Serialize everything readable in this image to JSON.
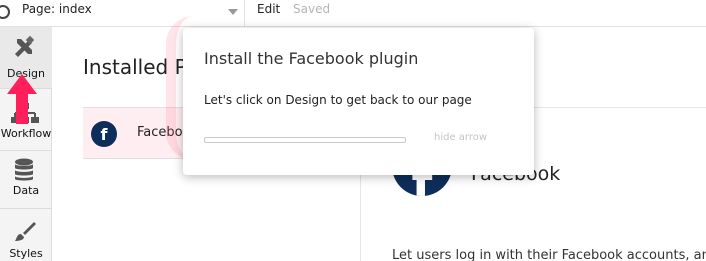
{
  "topbar": {
    "page_select_value": "Page: index",
    "edit_label": "Edit",
    "save_status": "Saved"
  },
  "sidebar": {
    "items": [
      {
        "label": "Design",
        "icon": "design-tools-icon"
      },
      {
        "label": "Workflow",
        "icon": "workflow-icon"
      },
      {
        "label": "Data",
        "icon": "database-icon"
      },
      {
        "label": "Styles",
        "icon": "brush-icon"
      }
    ]
  },
  "main": {
    "title": "Installed Pl",
    "plugins": [
      {
        "name": "Facebo",
        "icon": "facebook-icon"
      }
    ],
    "detail": {
      "icon_glyph": "f",
      "name": "Facebook",
      "description": "Let users log in with their Facebook accounts, an"
    }
  },
  "popup": {
    "title": "Install the Facebook plugin",
    "body": "Let's click on Design to get back to our page",
    "progress": 0,
    "hide_arrow_label": "hide arrow"
  },
  "colors": {
    "accent_pink": "#ff1f5a",
    "facebook_navy": "#0d2e5a"
  }
}
